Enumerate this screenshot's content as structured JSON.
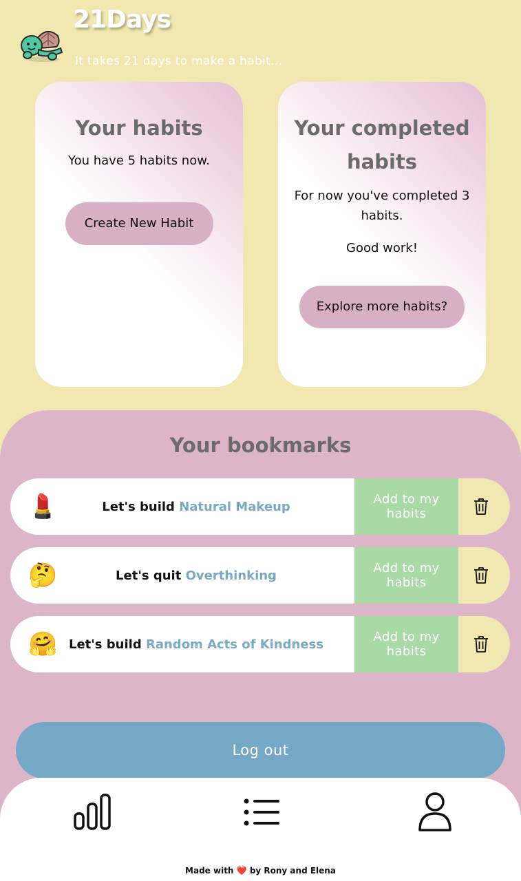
{
  "header": {
    "app_title": "21Days",
    "tagline": "It takes 21 days to make a habit..."
  },
  "habits_card": {
    "title": "Your habits",
    "text": "You have 5 habits now.",
    "button_label": "Create New Habit"
  },
  "completed_card": {
    "title": "Your completed habits",
    "text": "For now you've completed 3 habits.",
    "praise": "Good work!",
    "button_label": "Explore more habits?"
  },
  "bookmarks": {
    "title": "Your bookmarks",
    "items": [
      {
        "emoji": "💄",
        "icon": "lipstick-emoji",
        "verb": "Let's build",
        "habit": "Natural Makeup",
        "add_label": "Add to my habits"
      },
      {
        "emoji": "🤔",
        "icon": "thinking-face-emoji",
        "verb": "Let's quit",
        "habit": "Overthinking",
        "add_label": "Add to my habits"
      },
      {
        "emoji": "🤗",
        "icon": "hugging-face-emoji",
        "verb": "Let's build",
        "habit": "Random Acts of Kindness",
        "add_label": "Add to my habits"
      }
    ]
  },
  "logout_label": "Log out",
  "nav": {
    "items": [
      {
        "icon": "bar-chart-icon"
      },
      {
        "icon": "list-icon"
      },
      {
        "icon": "user-icon"
      }
    ]
  },
  "footer": {
    "prefix": "Made with",
    "heart": "❤️",
    "suffix": "by Rony and Elena"
  },
  "colors": {
    "background": "#f0e8b0",
    "pink": "#dcb5c9",
    "button_pink": "#d7b0c6",
    "green": "#a9d9a4",
    "blue": "#74a8c6",
    "habit_text": "#79a9c4"
  }
}
